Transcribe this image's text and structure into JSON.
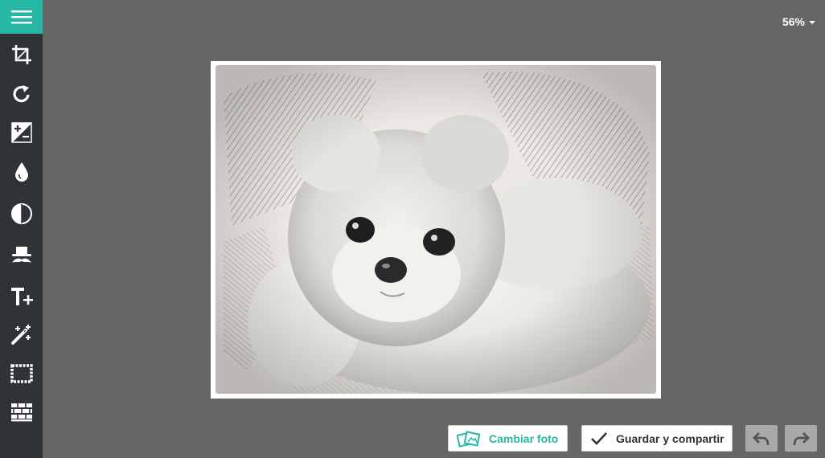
{
  "sidebar": {
    "menu_icon": "hamburger-menu-icon",
    "tools": [
      {
        "id": "crop",
        "icon": "crop-icon"
      },
      {
        "id": "rotate",
        "icon": "rotate-icon"
      },
      {
        "id": "exposure",
        "icon": "exposure-icon"
      },
      {
        "id": "color",
        "icon": "drop-icon"
      },
      {
        "id": "effects",
        "icon": "contrast-icon"
      },
      {
        "id": "stickers",
        "icon": "hat-mustache-icon"
      },
      {
        "id": "text",
        "icon": "add-text-icon"
      },
      {
        "id": "retouch",
        "icon": "magic-wand-icon"
      },
      {
        "id": "frames",
        "icon": "frame-icon"
      },
      {
        "id": "textures",
        "icon": "texture-icon"
      }
    ]
  },
  "zoom": {
    "value": "56%"
  },
  "canvas": {
    "image": "pencil-sketch-puppy-photo"
  },
  "actions": {
    "change_photo_label": "Cambiar foto",
    "save_share_label": "Guardar y compartir",
    "undo_icon": "undo-icon",
    "redo_icon": "redo-icon"
  },
  "colors": {
    "accent": "#25b7a6",
    "sidebar": "#2f3338",
    "background": "#666666"
  }
}
